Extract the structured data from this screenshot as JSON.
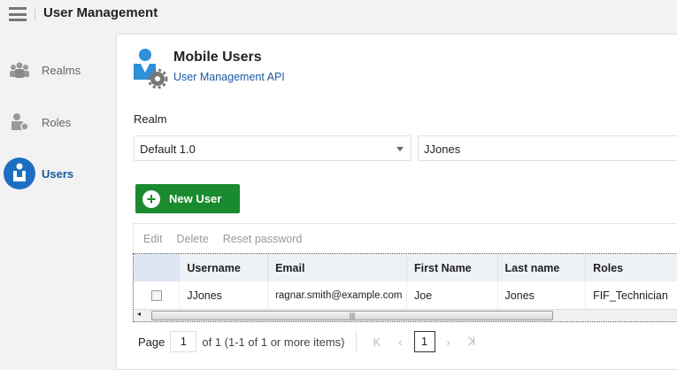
{
  "header": {
    "title": "User Management"
  },
  "sidebar": {
    "items": [
      {
        "label": "Realms"
      },
      {
        "label": "Roles"
      },
      {
        "label": "Users",
        "active": true
      }
    ]
  },
  "main": {
    "title": "Mobile Users",
    "subtitle": "User Management API",
    "realm_label": "Realm",
    "realm_value": "Default 1.0",
    "search_value": "JJones",
    "new_user_label": "New User",
    "toolbar": {
      "edit": "Edit",
      "delete": "Delete",
      "reset": "Reset password"
    },
    "table": {
      "columns": [
        "Username",
        "Email",
        "First Name",
        "Last name",
        "Roles"
      ],
      "rows": [
        [
          "JJones",
          "ragnar.smith@example.com",
          "Joe",
          "Jones",
          "FIF_Technician"
        ]
      ]
    },
    "pagination": {
      "page_label": "Page",
      "page_value": "1",
      "summary": "of 1 (1-1 of 1 or more items)",
      "current": "1"
    }
  },
  "colors": {
    "accent": "#1c5aa0",
    "button": "#1a8a2e"
  }
}
